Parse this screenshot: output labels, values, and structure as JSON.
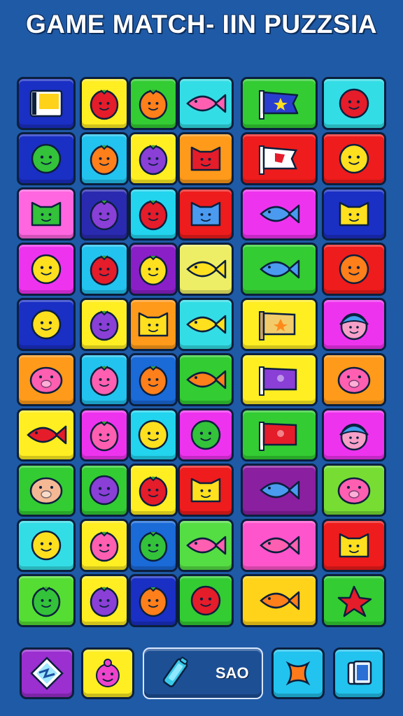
{
  "title": "GAME MATCH- IIN PUZZSIA",
  "board": {
    "rows": [
      [
        {
          "color": "#1a2fc4",
          "item": "flag-card"
        },
        {
          "color": "#ffee22",
          "item": "red-berry"
        },
        {
          "color": "#33cc33",
          "item": "orange-fruit"
        },
        {
          "color": "#33dde6",
          "item": "pink-fish"
        },
        {
          "color": "#33cc33",
          "item": "blue-star-flag"
        },
        {
          "color": "#33dde6",
          "item": "red-smiley"
        }
      ],
      [
        {
          "color": "#1a2fc4",
          "item": "green-blob"
        },
        {
          "color": "#22c3ee",
          "item": "orange-fruit"
        },
        {
          "color": "#ffee22",
          "item": "purple-fruit"
        },
        {
          "color": "#ff9a1a",
          "item": "red-cat"
        },
        {
          "color": "#ee1c1c",
          "item": "white-flag"
        },
        {
          "color": "#ee1c1c",
          "item": "yellow-smiley"
        }
      ],
      [
        {
          "color": "#ff66e0",
          "item": "green-cat"
        },
        {
          "color": "#2a2ab0",
          "item": "purple-fruit"
        },
        {
          "color": "#22d4ee",
          "item": "red-fruit"
        },
        {
          "color": "#ee1c1c",
          "item": "blue-cat"
        },
        {
          "color": "#ee33ee",
          "item": "blue-fish"
        },
        {
          "color": "#1a2fc4",
          "item": "yellow-cat"
        }
      ],
      [
        {
          "color": "#ee33ee",
          "item": "yellow-smiley"
        },
        {
          "color": "#22c3ee",
          "item": "red-fruit"
        },
        {
          "color": "#8a1fc7",
          "item": "yellow-fruit"
        },
        {
          "color": "#eeee66",
          "item": "yellow-fish"
        },
        {
          "color": "#33cc33",
          "item": "blue-fish"
        },
        {
          "color": "#ee1c1c",
          "item": "orange-smiley"
        }
      ],
      [
        {
          "color": "#1a2fc4",
          "item": "yellow-blob"
        },
        {
          "color": "#ffee22",
          "item": "purple-fruit"
        },
        {
          "color": "#ff9a1a",
          "item": "yellow-cat"
        },
        {
          "color": "#33dde6",
          "item": "yellow-fish"
        },
        {
          "color": "#ffee22",
          "item": "scroll-flag"
        },
        {
          "color": "#ee33ee",
          "item": "blue-hair-face"
        }
      ],
      [
        {
          "color": "#ff9a1a",
          "item": "pink-pig"
        },
        {
          "color": "#22c3ee",
          "item": "pink-fruit"
        },
        {
          "color": "#1a6ad8",
          "item": "orange-fruit"
        },
        {
          "color": "#33cc33",
          "item": "orange-fish"
        },
        {
          "color": "#ffee22",
          "item": "purple-flag"
        },
        {
          "color": "#ff9a1a",
          "item": "pink-pig"
        }
      ],
      [
        {
          "color": "#ffee22",
          "item": "red-fish"
        },
        {
          "color": "#ee33ee",
          "item": "pink-fruit"
        },
        {
          "color": "#22d4ee",
          "item": "yellow-smiley"
        },
        {
          "color": "#ee33ee",
          "item": "green-blob"
        },
        {
          "color": "#33cc33",
          "item": "red-flag"
        },
        {
          "color": "#ee33ee",
          "item": "blue-hair-face"
        }
      ],
      [
        {
          "color": "#33cc33",
          "item": "peach-pig"
        },
        {
          "color": "#33cc33",
          "item": "purple-smiley"
        },
        {
          "color": "#ffee22",
          "item": "red-fruit"
        },
        {
          "color": "#ee1c1c",
          "item": "yellow-cat"
        },
        {
          "color": "#8a1fa0",
          "item": "blue-fish"
        },
        {
          "color": "#77dd33",
          "item": "pink-pig"
        }
      ],
      [
        {
          "color": "#33dde6",
          "item": "yellow-blob"
        },
        {
          "color": "#ffee22",
          "item": "pink-fruit"
        },
        {
          "color": "#1a6ad8",
          "item": "green-fruit"
        },
        {
          "color": "#55dd44",
          "item": "pink-fish"
        },
        {
          "color": "#ff55cc",
          "item": "pink-fish"
        },
        {
          "color": "#ee1c1c",
          "item": "yellow-cat"
        }
      ],
      [
        {
          "color": "#55dd33",
          "item": "green-fruit"
        },
        {
          "color": "#ffee22",
          "item": "purple-fruit"
        },
        {
          "color": "#1a2fc4",
          "item": "orange-fruit"
        },
        {
          "color": "#33cc33",
          "item": "red-smiley"
        },
        {
          "color": "#ffd31a",
          "item": "orange-fish"
        },
        {
          "color": "#33cc33",
          "item": "red-star"
        }
      ]
    ]
  },
  "toolbar": {
    "diamond_color": "#9b2fd0",
    "pig_color": "#ffee22",
    "save_label": "SAO",
    "shuffle_color": "#22c3ee",
    "cards_color": "#22c3ee"
  }
}
